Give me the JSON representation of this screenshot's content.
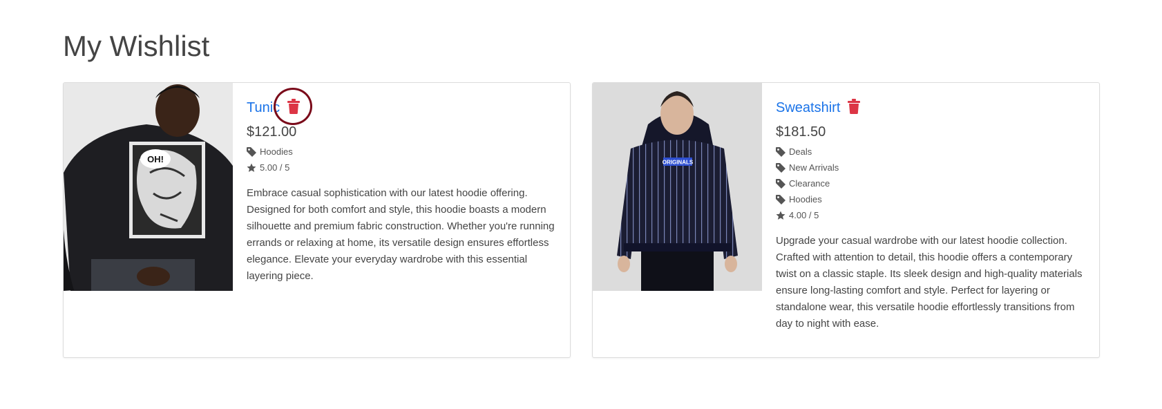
{
  "page": {
    "title": "My Wishlist"
  },
  "items": [
    {
      "name": "Tunic",
      "price": "$121.00",
      "tags": [
        "Hoodies"
      ],
      "rating": "5.00 / 5",
      "description": "Embrace casual sophistication with our latest hoodie offering. Designed for both comfort and style, this hoodie boasts a modern silhouette and premium fabric construction. Whether you're running errands or relaxing at home, its versatile design ensures effortless elegance. Elevate your everyday wardrobe with this essential layering piece."
    },
    {
      "name": "Sweatshirt",
      "price": "$181.50",
      "tags": [
        "Deals",
        "New Arrivals",
        "Clearance",
        "Hoodies"
      ],
      "rating": "4.00 / 5",
      "description": "Upgrade your casual wardrobe with our latest hoodie collection. Crafted with attention to detail, this hoodie offers a contemporary twist on a classic staple. Its sleek design and high-quality materials ensure long-lasting comfort and style. Perfect for layering or standalone wear, this versatile hoodie effortlessly transitions from day to night with ease."
    }
  ],
  "icons": {
    "remove": "trash-icon",
    "tag": "tag-icon",
    "rating": "star-icon"
  },
  "colors": {
    "link": "#1a73e8",
    "delete": "#dc3545",
    "highlight": "#7a0a1a"
  },
  "image_text": {
    "sweatshirt_print": "ORIGINALS",
    "tunic_print": "OH!"
  }
}
